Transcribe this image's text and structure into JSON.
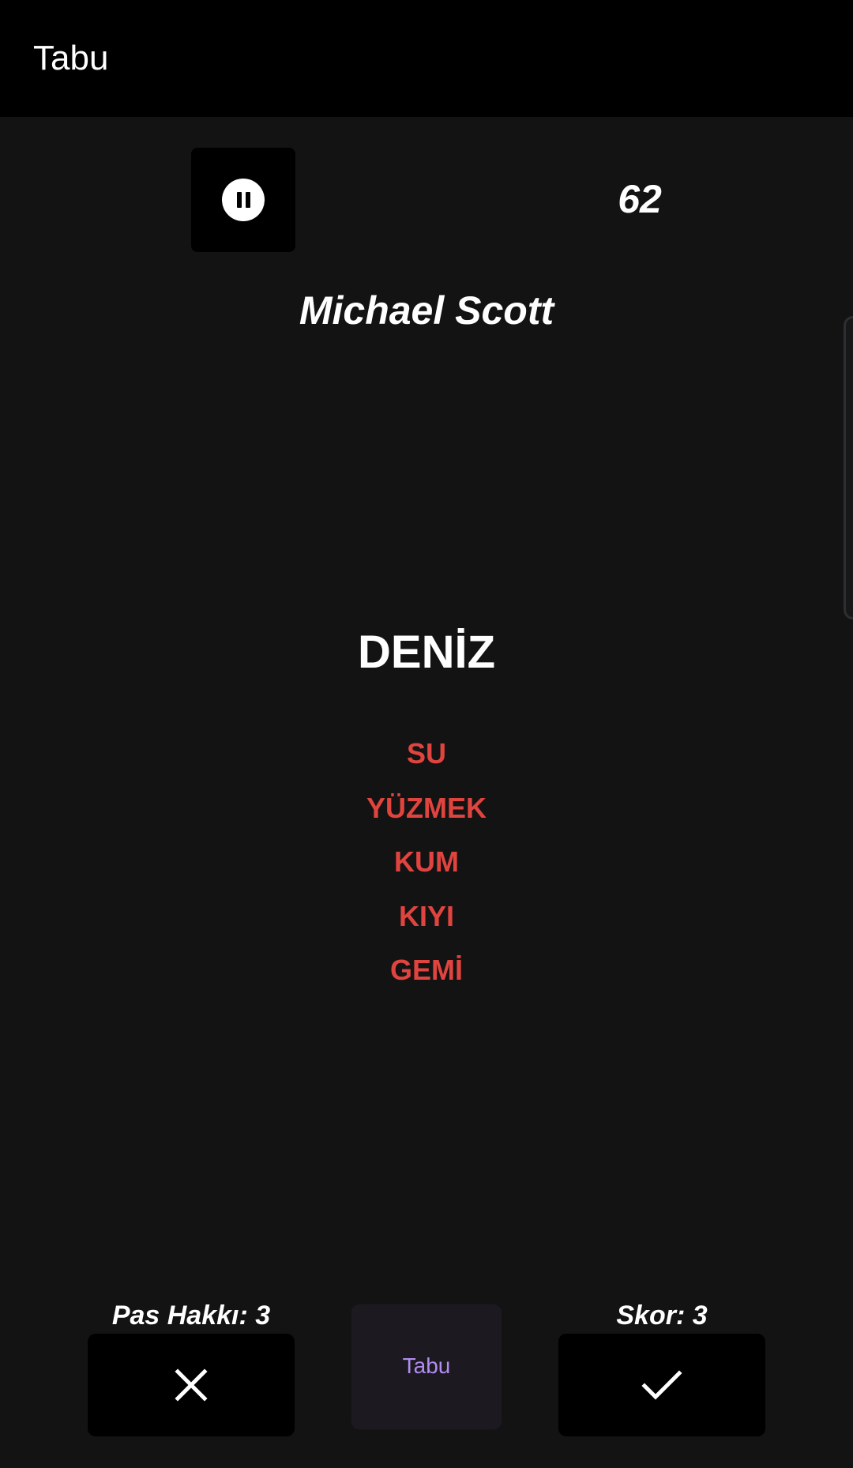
{
  "app_bar": {
    "title": "Tabu"
  },
  "game": {
    "pause_icon": "pause-circle-icon",
    "timer": "62",
    "player_name": "Michael Scott",
    "card": {
      "word": "DENİZ",
      "taboo_words": [
        "SU",
        "YÜZMEK",
        "KUM",
        "KIYI",
        "GEMİ"
      ]
    }
  },
  "footer": {
    "pass_label": "Pas Hakkı: 3",
    "score_label": "Skor: 3",
    "pass_icon": "close-icon",
    "correct_icon": "check-icon",
    "taboo_button_label": "Tabu"
  },
  "colors": {
    "background": "#141314",
    "app_bar": "#000000",
    "taboo_word": "#e0443f",
    "taboo_button_text": "#b28cf0"
  }
}
